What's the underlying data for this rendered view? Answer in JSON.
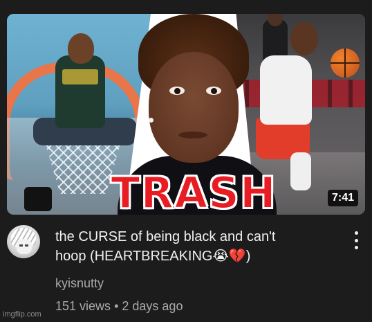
{
  "video": {
    "thumbnail_text": "TRASH",
    "duration": "7:41",
    "title_line1": "the CURSE of being black and can't",
    "title_line2": "hoop (HEARTBREAKING😭💔)",
    "channel": "kyisnutty",
    "views": "151 views",
    "separator": "•",
    "age": "2 days ago"
  },
  "icons": {
    "more_actions": "kebab-menu-icon"
  },
  "watermark": "imgflip.com",
  "colors": {
    "background": "#1c1c1c",
    "title_text": "#f1f1f1",
    "secondary_text": "#aaaaaa",
    "thumbnail_banner": "#e81c23"
  }
}
